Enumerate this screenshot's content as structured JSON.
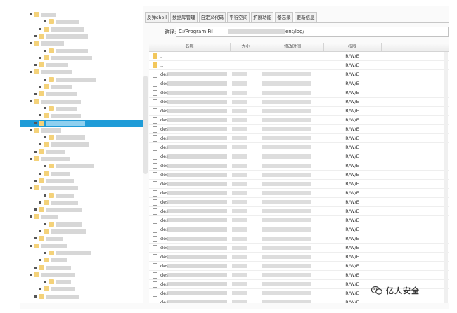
{
  "tabs": [
    {
      "label": "反弹shell",
      "active": false
    },
    {
      "label": "数据库管理",
      "active": false
    },
    {
      "label": "自定义代码",
      "active": false
    },
    {
      "label": "平行空间",
      "active": false
    },
    {
      "label": "扩展功能",
      "active": false
    },
    {
      "label": "备忘录",
      "active": false
    },
    {
      "label": "更新信息",
      "active": false
    }
  ],
  "path": {
    "label": "路径:",
    "value_start": "C:/Program Fil",
    "value_end": "ent/log/"
  },
  "table": {
    "headers": [
      "名称",
      "大小",
      "修改时间",
      "权限"
    ],
    "rows": [
      {
        "icon": "folder",
        "name": ".",
        "perm": "R/W/E"
      },
      {
        "icon": "folder",
        "name": "..",
        "perm": "R/W/E"
      },
      {
        "icon": "file",
        "name": "des",
        "perm": "R/W/E"
      },
      {
        "icon": "file",
        "name": "des",
        "perm": "R/W/E"
      },
      {
        "icon": "file",
        "name": "des",
        "perm": "R/W/E"
      },
      {
        "icon": "file",
        "name": "des",
        "perm": "R/W/E"
      },
      {
        "icon": "file",
        "name": "des",
        "perm": "R/W/E"
      },
      {
        "icon": "file",
        "name": "des",
        "perm": "R/W/E"
      },
      {
        "icon": "file",
        "name": "des",
        "perm": "R/W/E"
      },
      {
        "icon": "file",
        "name": "des",
        "perm": "R/W/E"
      },
      {
        "icon": "file",
        "name": "des",
        "perm": "R/W/E"
      },
      {
        "icon": "file",
        "name": "des",
        "perm": "R/W/E"
      },
      {
        "icon": "file",
        "name": "des",
        "perm": "R/W/E"
      },
      {
        "icon": "file",
        "name": "des",
        "perm": "R/W/E"
      },
      {
        "icon": "file",
        "name": "des",
        "perm": "R/W/E"
      },
      {
        "icon": "file",
        "name": "des",
        "perm": "R/W/E"
      },
      {
        "icon": "file",
        "name": "des",
        "perm": "R/W/E"
      },
      {
        "icon": "file",
        "name": "des",
        "perm": "R/W/E"
      },
      {
        "icon": "file",
        "name": "des",
        "perm": "R/W/E"
      },
      {
        "icon": "file",
        "name": "des",
        "perm": "R/W/E"
      },
      {
        "icon": "file",
        "name": "des",
        "perm": "R/W/E"
      },
      {
        "icon": "file",
        "name": "des",
        "perm": "R/W/E"
      },
      {
        "icon": "file",
        "name": "des",
        "perm": "R/W/E"
      },
      {
        "icon": "file",
        "name": "des",
        "perm": "R/W/E"
      },
      {
        "icon": "file",
        "name": "des",
        "perm": "R/W/E"
      },
      {
        "icon": "file",
        "name": "des",
        "perm": "R/W/E"
      },
      {
        "icon": "file",
        "name": "des",
        "perm": "R/W/E"
      },
      {
        "icon": "file",
        "name": "des",
        "perm": "R/W/E"
      }
    ]
  },
  "watermark": {
    "text": "亿人安全",
    "icon": "wechat-icon"
  },
  "colors": {
    "selection": "#1f9cd8",
    "folder": "#f2c75c"
  }
}
